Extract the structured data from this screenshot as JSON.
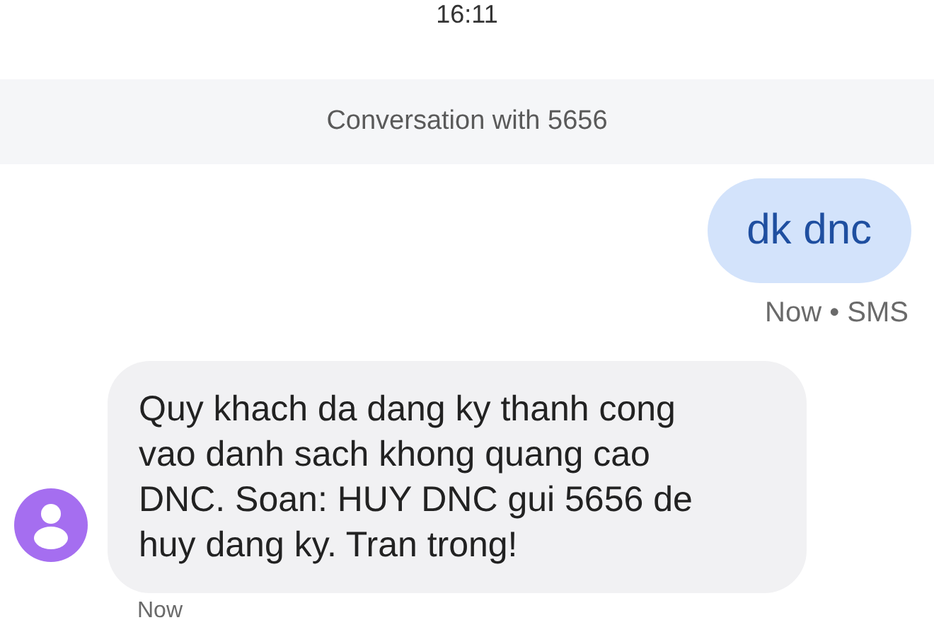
{
  "status_bar": {
    "time": "16:11"
  },
  "header": {
    "title": "Conversation with 5656"
  },
  "messages": [
    {
      "kind": "sent",
      "text": "dk dnc",
      "meta": "Now • SMS"
    },
    {
      "kind": "received",
      "text": "Quy khach da dang ky thanh cong\nvao danh sach khong quang cao\nDNC. Soan: HUY DNC gui 5656 de\nhuy dang ky. Tran trong!",
      "meta": "Now"
    }
  ]
}
